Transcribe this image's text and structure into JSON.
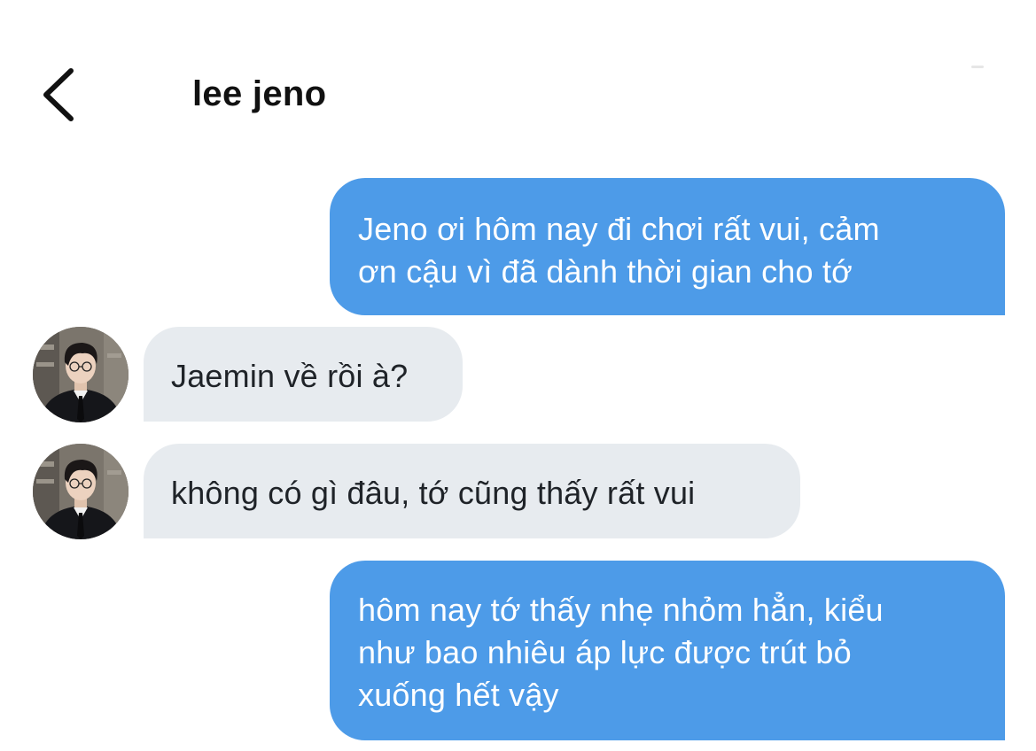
{
  "header": {
    "title": "lee jeno",
    "back_icon": "chevron-left-icon"
  },
  "colors": {
    "outgoing_bubble": "#4d9be8",
    "incoming_bubble": "#e7ebef",
    "outgoing_text": "#ffffff",
    "incoming_text": "#1f2328"
  },
  "messages": [
    {
      "direction": "outgoing",
      "lines": [
        "Jeno ơi hôm nay đi chơi rất vui, cảm",
        "ơn cậu vì đã dành thời gian cho tớ"
      ]
    },
    {
      "direction": "incoming",
      "avatar": "contact-avatar",
      "lines": [
        "Jaemin về rồi à?"
      ]
    },
    {
      "direction": "incoming",
      "avatar": "contact-avatar",
      "lines": [
        "không có gì đâu, tớ cũng thấy rất vui"
      ]
    },
    {
      "direction": "outgoing",
      "lines": [
        "hôm nay tớ thấy nhẹ nhỏm hẳn, kiểu",
        "như bao nhiêu áp lực được trút bỏ",
        "xuống hết vậy"
      ]
    }
  ]
}
